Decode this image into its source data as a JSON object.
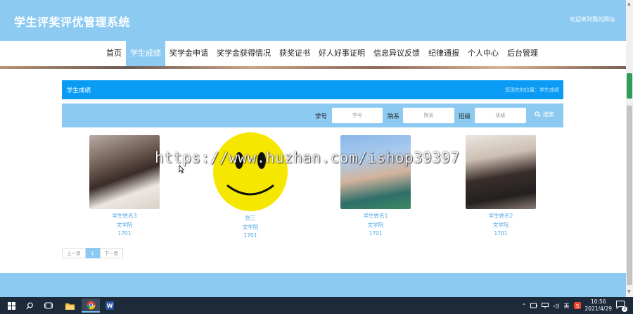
{
  "header": {
    "title": "学生评奖评优管理系统",
    "welcome": "欢迎来到我的网站"
  },
  "nav": {
    "items": [
      {
        "label": "首页",
        "active": false
      },
      {
        "label": "学生成绩",
        "active": true
      },
      {
        "label": "奖学金申请",
        "active": false
      },
      {
        "label": "奖学金获得情况",
        "active": false
      },
      {
        "label": "获奖证书",
        "active": false
      },
      {
        "label": "好人好事证明",
        "active": false
      },
      {
        "label": "信息异议反馈",
        "active": false
      },
      {
        "label": "纪律通报",
        "active": false
      },
      {
        "label": "个人中心",
        "active": false
      },
      {
        "label": "后台管理",
        "active": false
      }
    ]
  },
  "section": {
    "title": "学生成绩",
    "breadcrumb": "您现在的位置：学生成绩"
  },
  "search": {
    "student_id_label": "学号",
    "student_id_placeholder": "学号",
    "college_label": "院系",
    "college_placeholder": "院系",
    "class_label": "班级",
    "class_placeholder": "班级",
    "button_label": "搜索",
    "button_icon": "search-icon"
  },
  "students": [
    {
      "name": "学生姓名3",
      "college": "文学院",
      "class": "1701"
    },
    {
      "name": "张三",
      "college": "文学院",
      "class": "1701"
    },
    {
      "name": "学生姓名1",
      "college": "文学院",
      "class": "1701"
    },
    {
      "name": "学生姓名2",
      "college": "文学院",
      "class": "1701"
    }
  ],
  "pagination": {
    "prev": "上一页",
    "current": "1",
    "next": "下一页"
  },
  "watermark": "https://www.huzhan.com/ishop39397",
  "taskbar": {
    "ime": "英",
    "time": "10:56",
    "date": "2021/4/29",
    "notification_count": "3"
  },
  "colors": {
    "header_bg": "#8ccaf1",
    "section_bar": "#0a9cf5",
    "link_text": "#4da6e2"
  }
}
